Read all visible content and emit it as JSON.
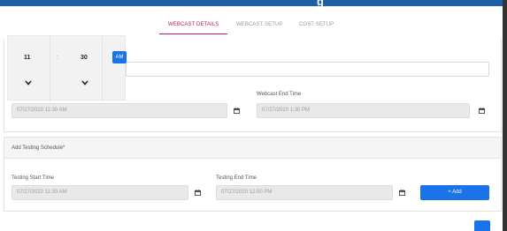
{
  "header": {
    "title_fragment": "g"
  },
  "tabs": [
    {
      "label": "WEBCAST DETAILS",
      "active": true
    },
    {
      "label": "WEBCAST SETUP",
      "active": false
    },
    {
      "label": "COST SETUP",
      "active": false
    }
  ],
  "time_picker": {
    "hour": "11",
    "separator": ":",
    "minute": "30",
    "period": "AM"
  },
  "webcast_times": {
    "start_value": "07/27/2020 11:30 AM",
    "end_label": "Webcast End Time",
    "end_value": "07/27/2020 1:30 PM"
  },
  "testing_schedule": {
    "heading": "Add Testing Schedule*",
    "start_label": "Testing Start Time",
    "start_value": "07/27/2020 11:30 AM",
    "end_label": "Testing End Time",
    "end_value": "07/27/2020 12:00 PM",
    "add_button": "+ Add"
  },
  "colors": {
    "accent": "#1a73e8",
    "active_tab": "#c2185b",
    "header": "#1d5fa8"
  }
}
